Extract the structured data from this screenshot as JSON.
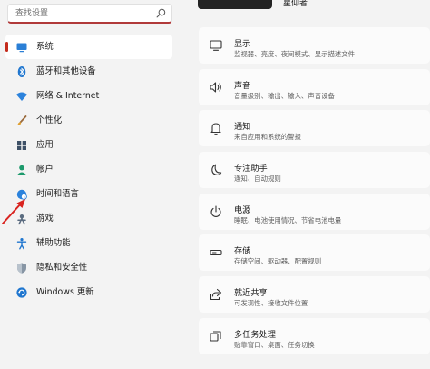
{
  "search": {
    "placeholder": "查找设置"
  },
  "user": {
    "name": "星仰者"
  },
  "colors": {
    "accent": "#c42b1c",
    "search_underline": "#b13a3a",
    "arrow": "#d9231f"
  },
  "sidebar": {
    "items": [
      {
        "label": "系统",
        "icon": "monitor-icon",
        "active": true
      },
      {
        "label": "蓝牙和其他设备",
        "icon": "bluetooth-icon"
      },
      {
        "label": "网络 & Internet",
        "icon": "wifi-icon"
      },
      {
        "label": "个性化",
        "icon": "brush-icon"
      },
      {
        "label": "应用",
        "icon": "apps-icon"
      },
      {
        "label": "帐户",
        "icon": "account-icon"
      },
      {
        "label": "时间和语言",
        "icon": "globe-clock-icon"
      },
      {
        "label": "游戏",
        "icon": "gamepad-icon"
      },
      {
        "label": "辅助功能",
        "icon": "accessibility-icon"
      },
      {
        "label": "隐私和安全性",
        "icon": "shield-icon"
      },
      {
        "label": "Windows 更新",
        "icon": "windows-update-icon"
      }
    ]
  },
  "main": {
    "cards": [
      {
        "title": "显示",
        "description": "监视器、亮度、夜间模式、显示描述文件",
        "icon": "display-icon"
      },
      {
        "title": "声音",
        "description": "音量级别、输出、输入、声音设备",
        "icon": "speaker-icon"
      },
      {
        "title": "通知",
        "description": "来自应用和系统的警报",
        "icon": "bell-icon"
      },
      {
        "title": "专注助手",
        "description": "通知、自动规则",
        "icon": "moon-icon"
      },
      {
        "title": "电源",
        "description": "睡眠、电池使用情况、节省电池电量",
        "icon": "power-icon"
      },
      {
        "title": "存储",
        "description": "存储空间、驱动器、配置规则",
        "icon": "storage-icon"
      },
      {
        "title": "就近共享",
        "description": "可发现性、接收文件位置",
        "icon": "share-icon"
      },
      {
        "title": "多任务处理",
        "description": "贴靠窗口、桌面、任务切换",
        "icon": "multitask-icon"
      }
    ]
  }
}
